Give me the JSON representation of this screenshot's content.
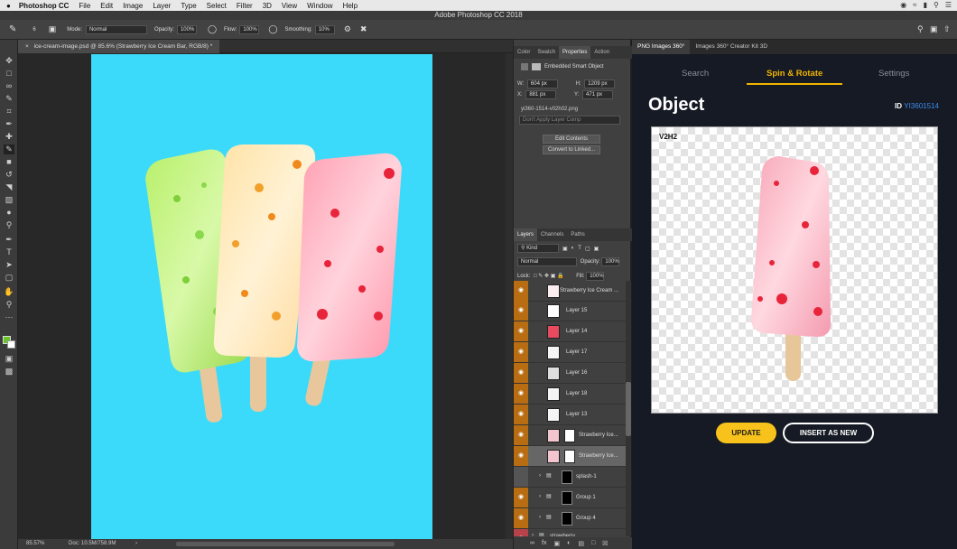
{
  "menubar": {
    "apple": "",
    "app": "Photoshop CC",
    "items": [
      "File",
      "Edit",
      "Image",
      "Layer",
      "Type",
      "Select",
      "Filter",
      "3D",
      "View",
      "Window",
      "Help"
    ]
  },
  "window_title": "Adobe Photoshop CC 2018",
  "options": {
    "brush_size": "6",
    "mode_label": "Mode:",
    "mode_value": "Normal",
    "opacity_label": "Opacity:",
    "opacity_value": "100%",
    "flow_label": "Flow:",
    "flow_value": "100%",
    "smoothing_label": "Smoothing:",
    "smoothing_value": "10%"
  },
  "document": {
    "tab_label": "ice-cream-image.psd @ 85.6% (Strawberry Ice Cream Bar, RGB/8) *",
    "zoom": "85.57%",
    "doc_info": "Doc: 10.5M/758.9M"
  },
  "properties": {
    "tabs": [
      "Color",
      "Swatch",
      "Properties",
      "Action"
    ],
    "header": "Embedded Smart Object",
    "w_label": "W:",
    "w_value": "604 px",
    "h_label": "H:",
    "h_value": "1209 px",
    "x_label": "X:",
    "x_value": "881 px",
    "y_label": "Y:",
    "y_value": "471 px",
    "filename": "yi360-1514-v02h02.png",
    "layer_comp": "Don't Apply Layer Comp",
    "edit_contents": "Edit Contents",
    "convert_linked": "Convert to Linked..."
  },
  "layers": {
    "tabs": [
      "Layers",
      "Channels",
      "Paths"
    ],
    "kind": "Kind",
    "blend": "Normal",
    "opacity_label": "Opacity:",
    "opacity_value": "100%",
    "lock_label": "Lock:",
    "fill_label": "Fill:",
    "fill_value": "100%",
    "rows": [
      "Strawberry Ice Cream ...",
      "Layer 15",
      "Layer 14",
      "Layer 17",
      "Layer 16",
      "Layer 18",
      "Layer 13",
      "Strawberry Ice...",
      "Strawberry Ice...",
      "splash-1",
      "Group 1",
      "Group 4",
      "strawberry"
    ]
  },
  "plugin": {
    "tabs": [
      "PNG Images 360°",
      "Images 360° Creator Kit 3D"
    ],
    "nav": [
      "Search",
      "Spin & Rotate",
      "Settings"
    ],
    "title": "Object",
    "id_label": "ID",
    "id_value": "YI3601514",
    "view_label": "V2H2",
    "update_btn": "UPDATE",
    "insert_btn": "INSERT AS NEW"
  },
  "colors": {
    "canvas_bg": "#3cdafa",
    "accent": "#f7c21b",
    "id_link": "#3d8ef0",
    "layer_eye": "#b86d13"
  }
}
